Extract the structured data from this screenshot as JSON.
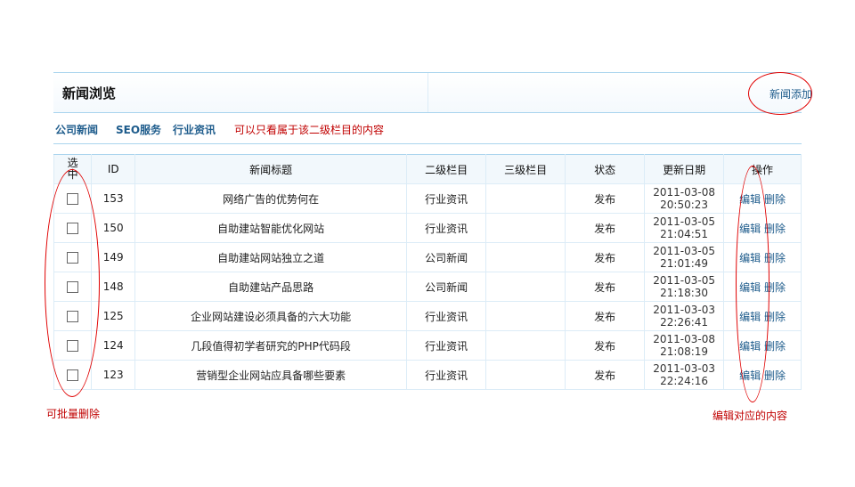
{
  "header": {
    "title": "新闻浏览",
    "add_link": "新闻添加"
  },
  "categories": {
    "items": [
      "公司新闻",
      "SEO服务",
      "行业资讯"
    ],
    "note": "可以只看属于该二级栏目的内容"
  },
  "table": {
    "columns": [
      "选中",
      "ID",
      "新闻标题",
      "二级栏目",
      "三级栏目",
      "状态",
      "更新日期",
      "操作"
    ],
    "rows": [
      {
        "id": "153",
        "title": "网络广告的优势何在",
        "cat2": "行业资讯",
        "cat3": "",
        "status": "发布",
        "date": "2011-03-08",
        "time": "20:50:23",
        "edit": "编辑",
        "del": "删除"
      },
      {
        "id": "150",
        "title": "自助建站智能优化网站",
        "cat2": "行业资讯",
        "cat3": "",
        "status": "发布",
        "date": "2011-03-05",
        "time": "21:04:51",
        "edit": "编辑",
        "del": "删除"
      },
      {
        "id": "149",
        "title": "自助建站网站独立之道",
        "cat2": "公司新闻",
        "cat3": "",
        "status": "发布",
        "date": "2011-03-05",
        "time": "21:01:49",
        "edit": "编辑",
        "del": "删除"
      },
      {
        "id": "148",
        "title": "自助建站产品思路",
        "cat2": "公司新闻",
        "cat3": "",
        "status": "发布",
        "date": "2011-03-05",
        "time": "21:18:30",
        "edit": "编辑",
        "del": "删除"
      },
      {
        "id": "125",
        "title": "企业网站建设必须具备的六大功能",
        "cat2": "行业资讯",
        "cat3": "",
        "status": "发布",
        "date": "2011-03-03",
        "time": "22:26:41",
        "edit": "编辑",
        "del": "删除"
      },
      {
        "id": "124",
        "title": "几段值得初学者研究的PHP代码段",
        "cat2": "行业资讯",
        "cat3": "",
        "status": "发布",
        "date": "2011-03-08",
        "time": "21:08:19",
        "edit": "编辑",
        "del": "删除"
      },
      {
        "id": "123",
        "title": "营销型企业网站应具备哪些要素",
        "cat2": "行业资讯",
        "cat3": "",
        "status": "发布",
        "date": "2011-03-03",
        "time": "22:24:16",
        "edit": "编辑",
        "del": "删除"
      }
    ]
  },
  "annotations": {
    "batch_delete": "可批量删除",
    "edit_content": "编辑对应的内容"
  },
  "colors": {
    "accent": "#1e5c8c",
    "note": "#c00000",
    "border": "#a9d4ee"
  }
}
